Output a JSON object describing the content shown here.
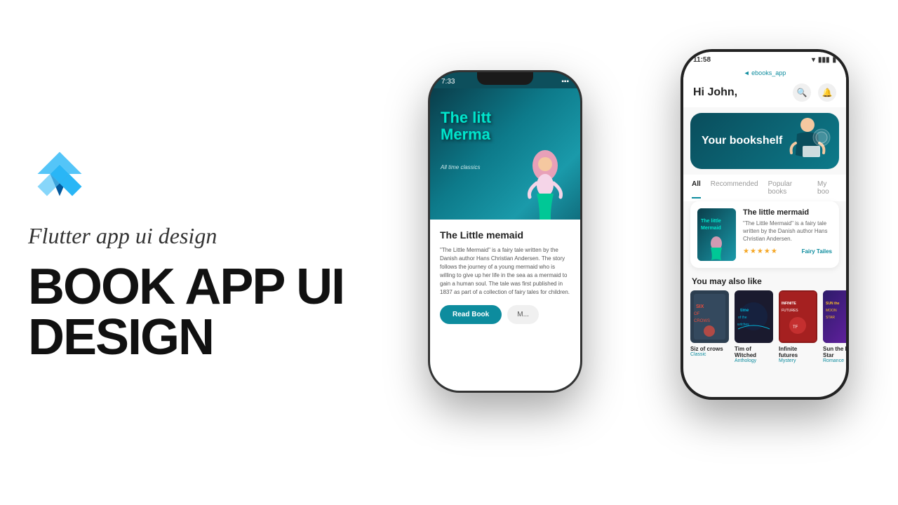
{
  "left": {
    "subtitle": "Flutter app ui design",
    "title_line1": "BOOK APP UI",
    "title_line2": "DESIGN"
  },
  "phone_back": {
    "status_time": "7:33",
    "hero_title_line1": "The litt",
    "hero_title_line2": "Merma",
    "hero_subtitle": "All time classics",
    "book_title": "The Little memaid",
    "description": "\"The Little Mermaid\" is a fairy tale written by the Danish author Hans Christian Andersen. The story follows the journey of a young mermaid who is willing to give up her life in the sea as a mermaid to gain a human soul. The tale was first published in 1837 as part of a collection of fairy tales for children.",
    "btn_read": "Read Book",
    "btn_more": "M..."
  },
  "phone_front": {
    "status_time": "11:58",
    "app_label": "◄ ebooks_app",
    "greeting": "Hi John,",
    "bookshelf_label": "Your bookshelf",
    "tabs": [
      "All",
      "Recommended",
      "Popular books",
      "My boo"
    ],
    "active_tab": "All",
    "featured_book": {
      "title": "The little mermaid",
      "description": "\"The Little Mermaid\" is a fairy tale written by the Danish author Hans Christian Andersen.",
      "genre": "Fairy Tailes",
      "stars": "★★★★★"
    },
    "section_also_like": "You may also like",
    "also_like_books": [
      {
        "title": "Siz of crows",
        "genre": "Classic"
      },
      {
        "title": "Tim of Witched",
        "genre": "Anthology"
      },
      {
        "title": "Infinite futures",
        "genre": "Mystery"
      },
      {
        "title": "Sun the Moon Star",
        "genre": "Romance"
      }
    ]
  }
}
